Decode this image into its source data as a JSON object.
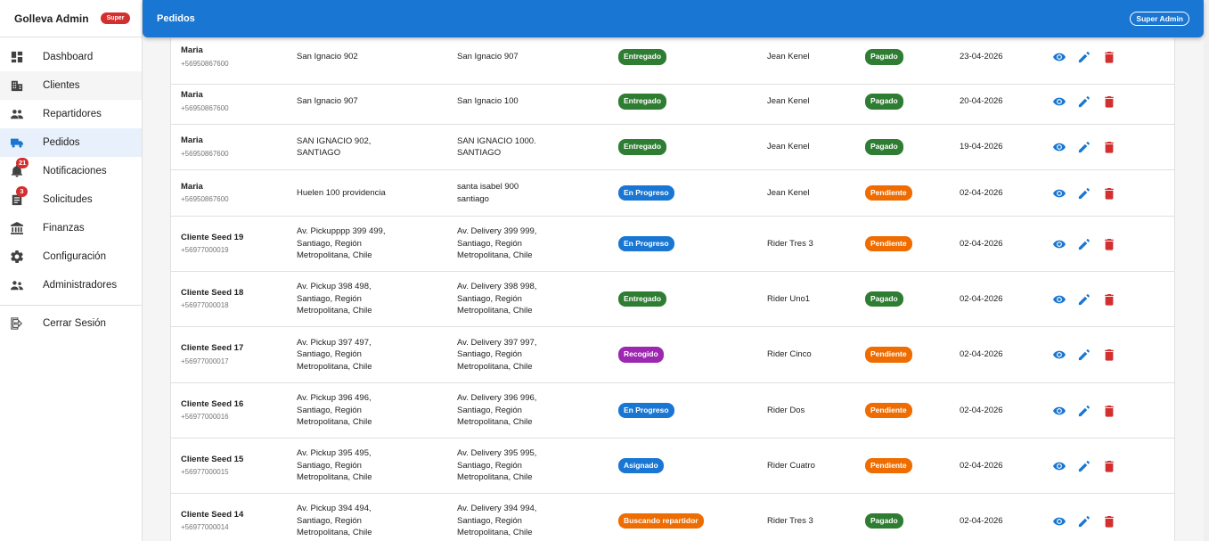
{
  "brand": {
    "title": "Golleva Admin",
    "badge": "Super"
  },
  "header": {
    "title": "Pedidos",
    "role_chip": "Super Admin"
  },
  "colors": {
    "primary": "#1976d2",
    "entregado": "#2e7d32",
    "en_progreso": "#1976d2",
    "recogido": "#9c27b0",
    "asignado": "#1976d2",
    "buscando": "#ef6c00",
    "pagado": "#2e7d32",
    "pendiente": "#ef6c00",
    "danger": "#d32f2f"
  },
  "sidebar": {
    "items": [
      {
        "label": "Dashboard",
        "icon": "dashboard-icon"
      },
      {
        "label": "Clientes",
        "icon": "building-icon"
      },
      {
        "label": "Repartidores",
        "icon": "people-icon"
      },
      {
        "label": "Pedidos",
        "icon": "truck-icon"
      },
      {
        "label": "Notificaciones",
        "icon": "bell-icon",
        "badge": "21"
      },
      {
        "label": "Solicitudes",
        "icon": "assignment-icon",
        "badge": "3"
      },
      {
        "label": "Finanzas",
        "icon": "bank-icon"
      },
      {
        "label": "Configuración",
        "icon": "gear-icon"
      },
      {
        "label": "Administradores",
        "icon": "admin-people-icon"
      }
    ],
    "logout": {
      "label": "Cerrar Sesión",
      "icon": "logout-icon"
    }
  },
  "orders": [
    {
      "name": "Maria",
      "phone": "+56950867600",
      "pickup": [
        "San Ignacio 902"
      ],
      "delivery": [
        "San Ignacio 907"
      ],
      "status": "Entregado",
      "status_key": "entregado",
      "rider": "Jean Kenel",
      "payment": "Pagado",
      "payment_key": "pagado",
      "date": "23-04-2026"
    },
    {
      "name": "Maria",
      "phone": "+56950867600",
      "pickup": [
        "San Ignacio 907"
      ],
      "delivery": [
        "San Ignacio 100"
      ],
      "status": "Entregado",
      "status_key": "entregado",
      "rider": "Jean Kenel",
      "payment": "Pagado",
      "payment_key": "pagado",
      "date": "20-04-2026"
    },
    {
      "name": "Maria",
      "phone": "+56950867600",
      "pickup": [
        "SAN IGNACIO 902,",
        "SANTIAGO"
      ],
      "delivery": [
        "SAN IGNACIO 1000.",
        "SANTIAGO"
      ],
      "status": "Entregado",
      "status_key": "entregado",
      "rider": "Jean Kenel",
      "payment": "Pagado",
      "payment_key": "pagado",
      "date": "19-04-2026"
    },
    {
      "name": "Maria",
      "phone": "+56950867600",
      "pickup": [
        "Huelen 100 providencia"
      ],
      "delivery": [
        "santa isabel 900",
        "santiago"
      ],
      "status": "En Progreso",
      "status_key": "en_progreso",
      "rider": "Jean Kenel",
      "payment": "Pendiente",
      "payment_key": "pendiente",
      "date": "02-04-2026"
    },
    {
      "name": "Cliente Seed 19",
      "phone": "+56977000019",
      "pickup": [
        "Av. Pickupppp 399 499,",
        "Santiago, Región",
        "Metropolitana, Chile"
      ],
      "delivery": [
        "Av. Delivery 399 999,",
        "Santiago, Región",
        "Metropolitana, Chile"
      ],
      "status": "En Progreso",
      "status_key": "en_progreso",
      "rider": "Rider Tres 3",
      "payment": "Pendiente",
      "payment_key": "pendiente",
      "date": "02-04-2026"
    },
    {
      "name": "Cliente Seed 18",
      "phone": "+56977000018",
      "pickup": [
        "Av. Pickup 398 498,",
        "Santiago, Región",
        "Metropolitana, Chile"
      ],
      "delivery": [
        "Av. Delivery 398 998,",
        "Santiago, Región",
        "Metropolitana, Chile"
      ],
      "status": "Entregado",
      "status_key": "entregado",
      "rider": "Rider Uno1",
      "payment": "Pagado",
      "payment_key": "pagado",
      "date": "02-04-2026"
    },
    {
      "name": "Cliente Seed 17",
      "phone": "+56977000017",
      "pickup": [
        "Av. Pickup 397 497,",
        "Santiago, Región",
        "Metropolitana, Chile"
      ],
      "delivery": [
        "Av. Delivery 397 997,",
        "Santiago, Región",
        "Metropolitana, Chile"
      ],
      "status": "Recogido",
      "status_key": "recogido",
      "rider": "Rider Cinco",
      "payment": "Pendiente",
      "payment_key": "pendiente",
      "date": "02-04-2026"
    },
    {
      "name": "Cliente Seed 16",
      "phone": "+56977000016",
      "pickup": [
        "Av. Pickup 396 496,",
        "Santiago, Región",
        "Metropolitana, Chile"
      ],
      "delivery": [
        "Av. Delivery 396 996,",
        "Santiago, Región",
        "Metropolitana, Chile"
      ],
      "status": "En Progreso",
      "status_key": "en_progreso",
      "rider": "Rider Dos",
      "payment": "Pendiente",
      "payment_key": "pendiente",
      "date": "02-04-2026"
    },
    {
      "name": "Cliente Seed 15",
      "phone": "+56977000015",
      "pickup": [
        "Av. Pickup 395 495,",
        "Santiago, Región",
        "Metropolitana, Chile"
      ],
      "delivery": [
        "Av. Delivery 395 995,",
        "Santiago, Región",
        "Metropolitana, Chile"
      ],
      "status": "Asignado",
      "status_key": "asignado",
      "rider": "Rider Cuatro",
      "payment": "Pendiente",
      "payment_key": "pendiente",
      "date": "02-04-2026"
    },
    {
      "name": "Cliente Seed 14",
      "phone": "+56977000014",
      "pickup": [
        "Av. Pickup 394 494,",
        "Santiago, Región",
        "Metropolitana, Chile"
      ],
      "delivery": [
        "Av. Delivery 394 994,",
        "Santiago, Región",
        "Metropolitana, Chile"
      ],
      "status": "Buscando repartidor",
      "status_key": "buscando",
      "rider": "Rider Tres 3",
      "payment": "Pagado",
      "payment_key": "pagado",
      "date": "02-04-2026"
    }
  ]
}
